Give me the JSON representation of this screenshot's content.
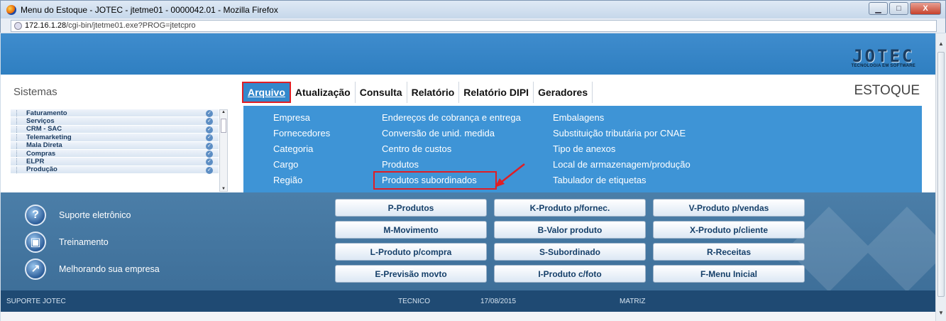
{
  "window": {
    "title": "Menu do Estoque - JOTEC - jtetme01 - 0000042.01 - Mozilla Firefox",
    "url_host": "172.16.1.28",
    "url_path": "/cgi-bin/jtetme01.exe?PROG=jtetcpro",
    "buttons": {
      "minimize": "▁",
      "maximize": "□",
      "close": "X"
    }
  },
  "logo": {
    "main": "JOTEC",
    "sub": "TECNOLOGIA EM SOFTWARE"
  },
  "header": {
    "left_title": "Sistemas",
    "right_title": "ESTOQUE"
  },
  "menu": [
    {
      "label": "Arquivo",
      "active": true
    },
    {
      "label": "Atualização"
    },
    {
      "label": "Consulta"
    },
    {
      "label": "Relatório"
    },
    {
      "label": "Relatório DIPI"
    },
    {
      "label": "Geradores"
    }
  ],
  "systems": [
    "Faturamento",
    "Serviços",
    "CRM - SAC",
    "Telemarketing",
    "Mala Direta",
    "Compras",
    "ELPR",
    "Produção"
  ],
  "dropdown": {
    "col1": [
      "Empresa",
      "Fornecedores",
      "Categoria",
      "Cargo",
      "Região"
    ],
    "col2": [
      "Endereços de cobrança e entrega",
      "Conversão de unid. medida",
      "Centro de custos",
      "Produtos",
      "Produtos subordinados"
    ],
    "col3": [
      "Embalagens",
      "Substituição tributária por CNAE",
      "Tipo de anexos",
      "Local de armazenagem/produção",
      "Tabulador de etiquetas"
    ]
  },
  "quick_links": [
    {
      "label": "Suporte eletrônico",
      "icon": "help-icon"
    },
    {
      "label": "Treinamento",
      "icon": "training-icon"
    },
    {
      "label": "Melhorando sua empresa",
      "icon": "chart-icon"
    }
  ],
  "buttons": [
    [
      "P-Produtos",
      "K-Produto p/fornec.",
      "V-Produto p/vendas"
    ],
    [
      "M-Movimento",
      "B-Valor produto",
      "X-Produto p/cliente"
    ],
    [
      "L-Produto p/compra",
      "S-Subordinado",
      "R-Receitas"
    ],
    [
      "E-Previsão movto",
      "I-Produto c/foto",
      "F-Menu Inicial"
    ]
  ],
  "status": {
    "left": "SUPORTE JOTEC",
    "user": "TECNICO",
    "date": "17/08/2015",
    "branch": "MATRIZ"
  },
  "colors": {
    "header_blue": "#3f8ccd",
    "dropdown_blue": "#3e94d6",
    "panel_blue": "#4b7ea8",
    "status_blue": "#1f4a73",
    "highlight_red": "#e01e25"
  }
}
